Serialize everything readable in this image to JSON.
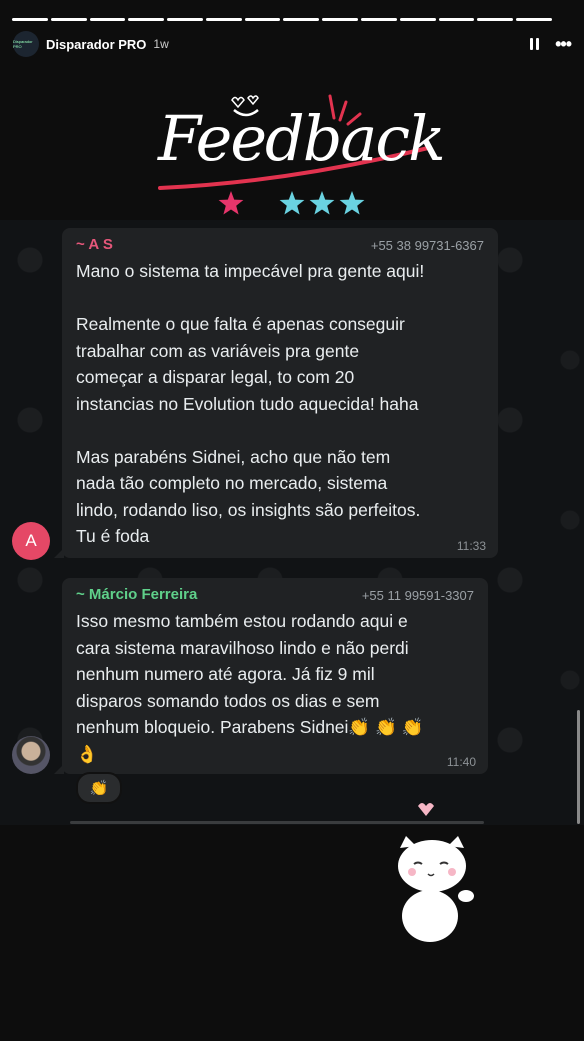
{
  "story": {
    "account": "Disparador PRO",
    "time_ago": "1w",
    "logo_text": "Disparador PRO",
    "progress_segments": 14
  },
  "banner": {
    "title": "Feedback",
    "star_colors": [
      "#e7356b",
      "#6ad2e0",
      "#6ad2e0",
      "#6ad2e0"
    ]
  },
  "messages": [
    {
      "sender": "~ A S",
      "sender_color": "#e5577a",
      "phone": "+55 38 99731-6367",
      "text": "Mano o sistema ta impecável pra gente aqui!\n\nRealmente o que falta é apenas conseguir\ntrabalhar com as variáveis pra gente\ncomeçar a disparar legal, to com 20\ninstancias no Evolution tudo aquecida! haha\n\nMas parabéns Sidnei, acho que não tem\nnada tão completo no mercado, sistema\nlindo, rodando liso, os insights são perfeitos.\nTu é foda",
      "time": "11:33",
      "avatar_letter": "A"
    },
    {
      "sender": "~ Márcio Ferreira",
      "sender_color": "#5fd08a",
      "phone": "+55 11 99591-3307",
      "text": "Isso mesmo também estou rodando aqui e\ncara sistema maravilhoso lindo e não perdi\nnenhum numero até agora. Já fiz 9 mil\ndisparos somando todos os dias e sem\nnenhum bloqueio. Parabens Sidnei👏 👏 👏\n👌",
      "time": "11:40",
      "reaction": "👏"
    }
  ]
}
